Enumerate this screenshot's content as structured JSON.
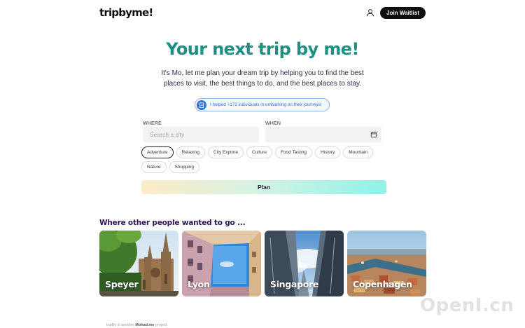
{
  "header": {
    "logo": "tripbyme!",
    "user_icon": "user-icon",
    "join_label": "Join Waitlist"
  },
  "hero": {
    "title": "Your next trip by me!",
    "subtitle": "It's Mo, let me plan your dream trip by helping you to find the best places to visit, the best things to do, and the best places to stay."
  },
  "badge": {
    "icon": "building-icon",
    "text": "I helped +172 individuals in embarking on their journeys!"
  },
  "form": {
    "where_label": "WHERE",
    "where_placeholder": "Search a city",
    "when_label": "WHEN",
    "when_value": "",
    "calendar_icon": "calendar-icon",
    "tags": [
      "Adventure",
      "Relaxing",
      "City Explore",
      "Culture",
      "Food Tasting",
      "History",
      "Mountain",
      "Nature",
      "Shopping"
    ],
    "active_tag": "Adventure",
    "plan_label": "Plan"
  },
  "destinations": {
    "title": "Where other people wanted to go ...",
    "cards": [
      {
        "name": "Speyer"
      },
      {
        "name": "Lyon"
      },
      {
        "name": "Singapore"
      },
      {
        "name": "Copenhagen"
      }
    ]
  },
  "footer": {
    "prefix": "tripBy is another",
    "brand": "Mohad.me",
    "suffix": "project"
  },
  "watermark": "OpenI.cn",
  "colors": {
    "title": "#1f8f83",
    "section_title": "#2d1559",
    "badge": "#3b74d9",
    "button_dark": "#0d0d0d"
  }
}
